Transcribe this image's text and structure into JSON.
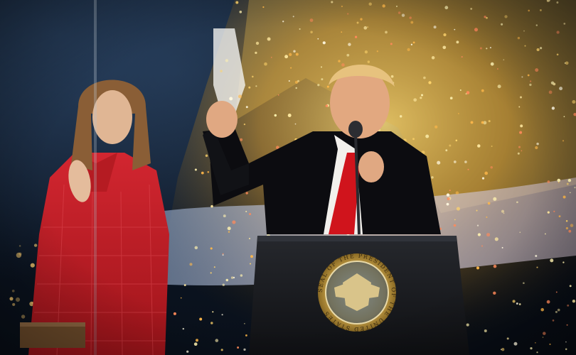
{
  "scene": {
    "description_free": true,
    "seal_text": "SEAL OF THE PRESIDENT OF THE UNITED STATES"
  },
  "colors": {
    "night_sky": "#0b1220",
    "warm_light": "#ffd46b",
    "red_dress": "#c21d24",
    "suit": "#0c0c10",
    "tie": "#d0141c",
    "podium": "#15171b",
    "seal_gold": "#c8a24a"
  }
}
